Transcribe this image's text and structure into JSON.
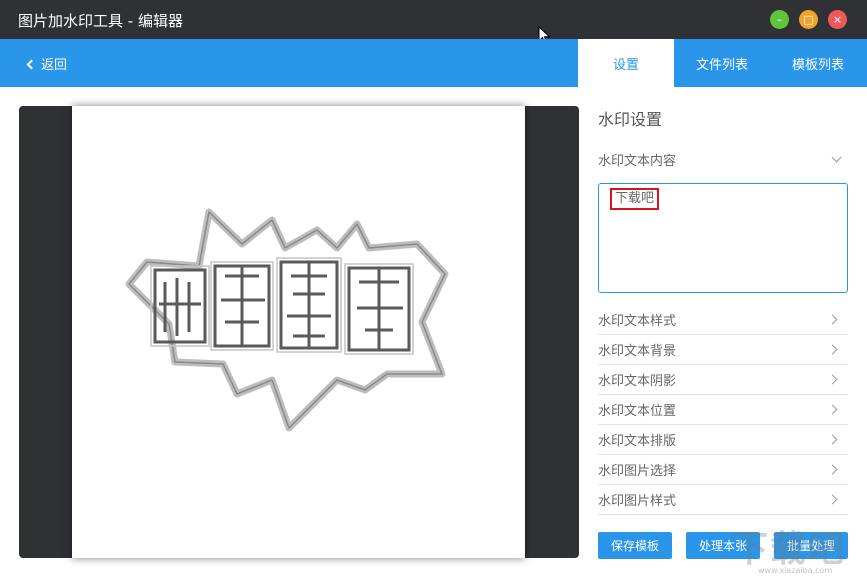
{
  "window": {
    "title": "图片加水印工具 - 编辑器"
  },
  "header": {
    "back_label": "返回",
    "tabs": [
      {
        "label": "设置",
        "active": true
      },
      {
        "label": "文件列表",
        "active": false
      },
      {
        "label": "模板列表",
        "active": false
      }
    ]
  },
  "settings": {
    "title": "水印设置",
    "content_label": "水印文本内容",
    "text_value": "下载吧",
    "sections": [
      "水印文本样式",
      "水印文本背景",
      "水印文本阴影",
      "水印文本位置",
      "水印文本排版",
      "水印图片选择",
      "水印图片样式"
    ]
  },
  "actions": {
    "save_template": "保存模板",
    "process_one": "处理本张",
    "batch_process": "批量处理"
  },
  "colors": {
    "accent": "#2996ea",
    "titlebar": "#2f3135",
    "highlight": "#d8151c"
  },
  "watermark": {
    "big": "下载吧",
    "small": "www.xiazaiba.com"
  }
}
